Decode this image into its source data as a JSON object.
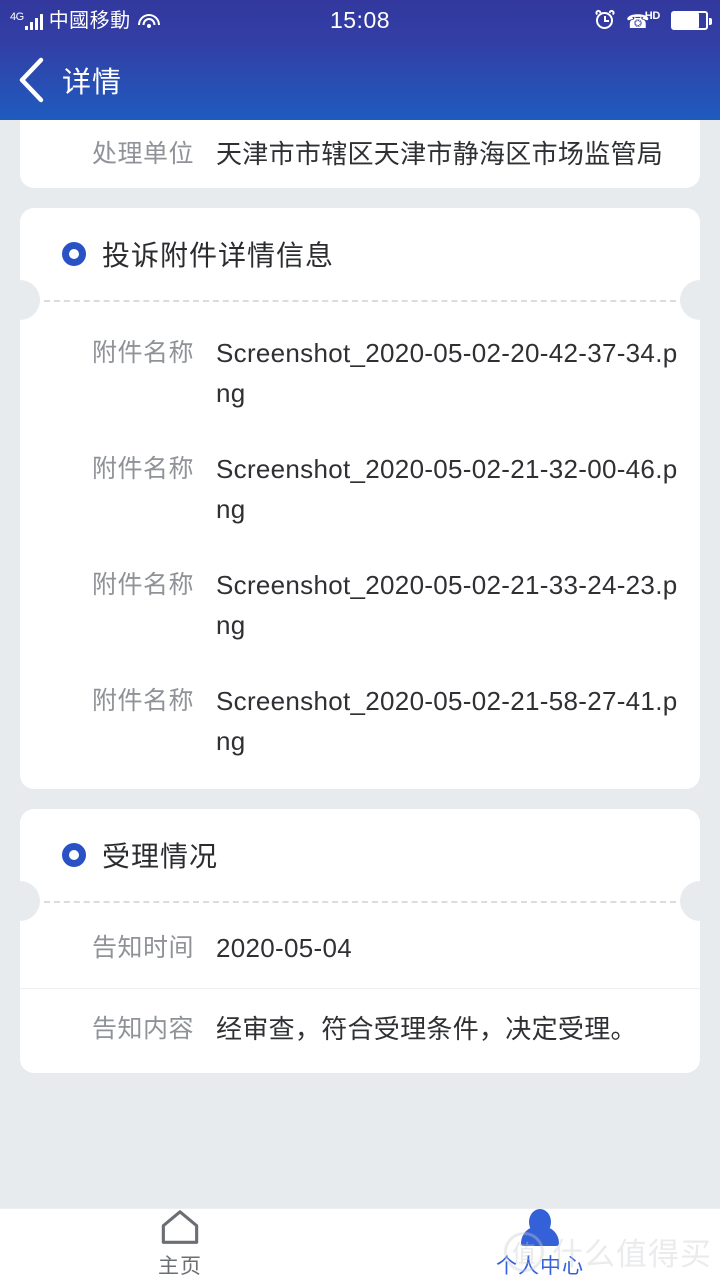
{
  "status_bar": {
    "network_type": "4G",
    "carrier": "中國移動",
    "time": "15:08",
    "icons": [
      "signal-icon",
      "wifi-icon",
      "alarm-icon",
      "volte-hd-icon",
      "battery-icon"
    ],
    "volte_label": "HD",
    "battery_level_percent": 78
  },
  "header": {
    "title": "详情",
    "back_label": "‹",
    "bg_color_top": "#333ea4",
    "bg_color_bottom": "#1f5bbf"
  },
  "theme": {
    "accent": "#2b52c4",
    "page_bg": "#e7ebee",
    "card_bg": "#ffffff",
    "label_color": "#8f9397",
    "value_color": "#2f3033",
    "tab_active_color": "#3461d8",
    "tab_inactive_color": "#6b6f73"
  },
  "top_card": {
    "rows": [
      {
        "label": "处理单位",
        "value": "天津市市辖区天津市静海区市场监管局"
      }
    ]
  },
  "attachment_section": {
    "title": "投诉附件详情信息",
    "icon": "ring-bullet-icon",
    "rows": [
      {
        "label": "附件名称",
        "value": "Screenshot_2020-05-02-20-42-37-34.png"
      },
      {
        "label": "附件名称",
        "value": "Screenshot_2020-05-02-21-32-00-46.png"
      },
      {
        "label": "附件名称",
        "value": "Screenshot_2020-05-02-21-33-24-23.png"
      },
      {
        "label": "附件名称",
        "value": "Screenshot_2020-05-02-21-58-27-41.png"
      }
    ]
  },
  "acceptance_section": {
    "title": "受理情况",
    "icon": "ring-bullet-icon",
    "rows": [
      {
        "label": "告知时间",
        "value": "2020-05-04"
      },
      {
        "label": "告知内容",
        "value": "经审查，符合受理条件，决定受理。"
      }
    ]
  },
  "tab_bar": {
    "tabs": [
      {
        "label": "主页",
        "icon": "home-icon",
        "active": false
      },
      {
        "label": "个人中心",
        "icon": "person-icon",
        "active": true
      }
    ]
  },
  "watermark": {
    "logo_char": "值",
    "text": "什么值得买"
  }
}
